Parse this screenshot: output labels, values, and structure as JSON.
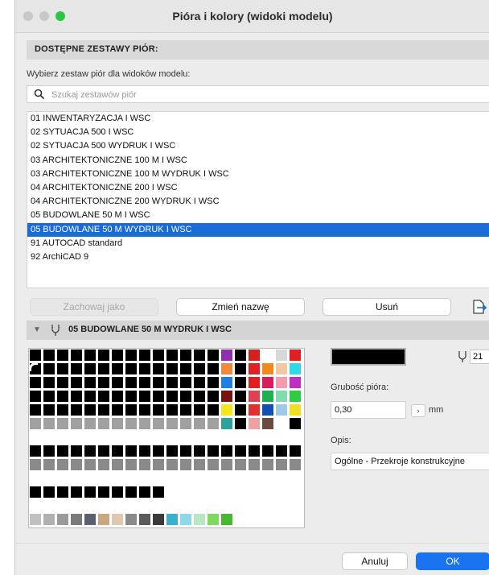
{
  "window": {
    "title": "Pióra i kolory (widoki modelu)"
  },
  "section": {
    "heading": "DOSTĘPNE ZESTAWY PIÓR:"
  },
  "prompt": "Wybierz zestaw piór dla widoków modelu:",
  "search": {
    "placeholder": "Szukaj zestawów piór",
    "value": "",
    "icon": "search-icon"
  },
  "pen_sets": [
    "01 INWENTARYZACJA I  WSC",
    "02 SYTUACJA 500 I WSC",
    "02 SYTUACJA 500 WYDRUK I WSC",
    "03 ARCHITEKTONICZNE 100 M I WSC",
    "03 ARCHITEKTONICZNE 100 M WYDRUK I WSC",
    "04 ARCHITEKTONICZNE 200 I WSC",
    "04 ARCHITEKTONICZNE 200 WYDRUK I WSC",
    "05 BUDOWLANE 50 M I WSC",
    "05 BUDOWLANE 50 M WYDRUK I WSC",
    "91 AUTOCAD standard",
    "92 ArchiCAD 9"
  ],
  "selected_index": 8,
  "buttons": {
    "save_as": "Zachowaj jako",
    "rename": "Zmień nazwę",
    "delete": "Usuń",
    "export_icon": "export-icon",
    "cancel": "Anuluj",
    "ok": "OK"
  },
  "pen_set_panel": {
    "title": "05 BUDOWLANE 50 M WYDRUK I WSC",
    "disclosure_icon": "triangle-down-icon",
    "pen_icon": "pen-icon"
  },
  "pen": {
    "number": "21",
    "color": "#000000",
    "weight_label": "Grubość pióra:",
    "weight_value": "0,30",
    "weight_unit": "mm",
    "description_label": "Opis:",
    "description_value": "Ogólne - Przekroje konstrukcyjne"
  },
  "palette": {
    "colors": {
      "black": "#000000",
      "gray": "#a0a0a0",
      "white": "#ffffff",
      "selected": "#1a6ad8"
    },
    "rows": [
      [
        "#000000",
        "#000000",
        "#000000",
        "#000000",
        "#000000",
        "#000000",
        "#000000",
        "#000000",
        "#000000",
        "#000000",
        "#000000",
        "#000000",
        "#000000",
        "#000000",
        "#8f2fb0",
        "#000000",
        "#d41f1f",
        "#ffffff",
        "#d8d8d8",
        "#e02020"
      ],
      [
        "#000000",
        "#000000",
        "#000000",
        "#000000",
        "#000000",
        "#000000",
        "#000000",
        "#000000",
        "#000000",
        "#000000",
        "#000000",
        "#000000",
        "#000000",
        "#000000",
        "#f08a3a",
        "#000000",
        "#e12020",
        "#f08a1a",
        "#f5c7a0",
        "#30d8e8"
      ],
      [
        "#000000",
        "#000000",
        "#000000",
        "#000000",
        "#000000",
        "#000000",
        "#000000",
        "#000000",
        "#000000",
        "#000000",
        "#000000",
        "#000000",
        "#000000",
        "#000000",
        "#1f7fe0",
        "#000000",
        "#e02020",
        "#d91c5c",
        "#f59ab0",
        "#c02ec0"
      ],
      [
        "#000000",
        "#000000",
        "#000000",
        "#000000",
        "#000000",
        "#000000",
        "#000000",
        "#000000",
        "#000000",
        "#000000",
        "#000000",
        "#000000",
        "#000000",
        "#000000",
        "#7a1010",
        "#000000",
        "#e04050",
        "#1db04e",
        "#7fdcb0",
        "#2ecc40"
      ],
      [
        "#000000",
        "#000000",
        "#000000",
        "#000000",
        "#000000",
        "#000000",
        "#000000",
        "#000000",
        "#000000",
        "#000000",
        "#000000",
        "#000000",
        "#000000",
        "#000000",
        "#f5e620",
        "#000000",
        "#e03030",
        "#1250b0",
        "#a0c8e8",
        "#f0e020"
      ],
      [
        "#a0a0a0",
        "#a0a0a0",
        "#a0a0a0",
        "#a0a0a0",
        "#a0a0a0",
        "#a0a0a0",
        "#a0a0a0",
        "#a0a0a0",
        "#a0a0a0",
        "#a0a0a0",
        "#a0a0a0",
        "#a0a0a0",
        "#a0a0a0",
        "#a0a0a0",
        "#2aa39a",
        "#000000",
        "#f0a0a0",
        "#6b4a40",
        "#ffffff",
        "#000000"
      ],
      [
        "#ffffff",
        "#ffffff",
        "#ffffff",
        "#ffffff",
        "#ffffff",
        "#ffffff",
        "#ffffff",
        "#ffffff",
        "#ffffff",
        "#ffffff",
        "#ffffff",
        "#ffffff",
        "#ffffff",
        "#ffffff",
        "#ffffff",
        "#ffffff",
        "#ffffff",
        "#ffffff",
        "#ffffff",
        "#ffffff"
      ],
      [
        "#000000",
        "#000000",
        "#000000",
        "#000000",
        "#000000",
        "#000000",
        "#000000",
        "#000000",
        "#000000",
        "#000000",
        "#000000",
        "#000000",
        "#000000",
        "#000000",
        "#000000",
        "#000000",
        "#000000",
        "#000000",
        "#000000",
        "#000000"
      ],
      [
        "#8a8a8a",
        "#8a8a8a",
        "#8a8a8a",
        "#8a8a8a",
        "#8a8a8a",
        "#8a8a8a",
        "#8a8a8a",
        "#8a8a8a",
        "#8a8a8a",
        "#8a8a8a",
        "#8a8a8a",
        "#8a8a8a",
        "#8a8a8a",
        "#8a8a8a",
        "#8a8a8a",
        "#8a8a8a",
        "#8a8a8a",
        "#8a8a8a",
        "#8a8a8a",
        "#8a8a8a"
      ],
      [
        "#ffffff",
        "#ffffff",
        "#ffffff",
        "#ffffff",
        "#ffffff",
        "#ffffff",
        "#ffffff",
        "#ffffff",
        "#ffffff",
        "#ffffff",
        "#ffffff",
        "#ffffff",
        "#ffffff",
        "#ffffff",
        "#ffffff",
        "#ffffff",
        "#ffffff",
        "#ffffff",
        "#ffffff",
        "#ffffff"
      ],
      [
        "#000000",
        "#000000",
        "#000000",
        "#000000",
        "#000000",
        "#000000",
        "#000000",
        "#000000",
        "#000000",
        "#000000",
        "#ffffff",
        "#ffffff",
        "#ffffff",
        "#ffffff",
        "#ffffff",
        "#ffffff",
        "#ffffff",
        "#ffffff",
        "#ffffff",
        "#ffffff"
      ],
      [
        "#ffffff",
        "#ffffff",
        "#ffffff",
        "#ffffff",
        "#ffffff",
        "#ffffff",
        "#ffffff",
        "#ffffff",
        "#ffffff",
        "#ffffff",
        "#ffffff",
        "#ffffff",
        "#ffffff",
        "#ffffff",
        "#ffffff",
        "#ffffff",
        "#ffffff",
        "#ffffff",
        "#ffffff",
        "#ffffff"
      ],
      [
        "#c0c0c0",
        "#b0b0b0",
        "#9a9a9a",
        "#7a7a7a",
        "#5a6070",
        "#c9a880",
        "#e0c8b0",
        "#8a8a8a",
        "#5a5a5a",
        "#3a3a3a",
        "#3ab0d0",
        "#8fd8e8",
        "#b8e8c0",
        "#80d860",
        "#48b830",
        "#ffffff",
        "#ffffff",
        "#ffffff",
        "#ffffff",
        "#ffffff"
      ]
    ]
  }
}
